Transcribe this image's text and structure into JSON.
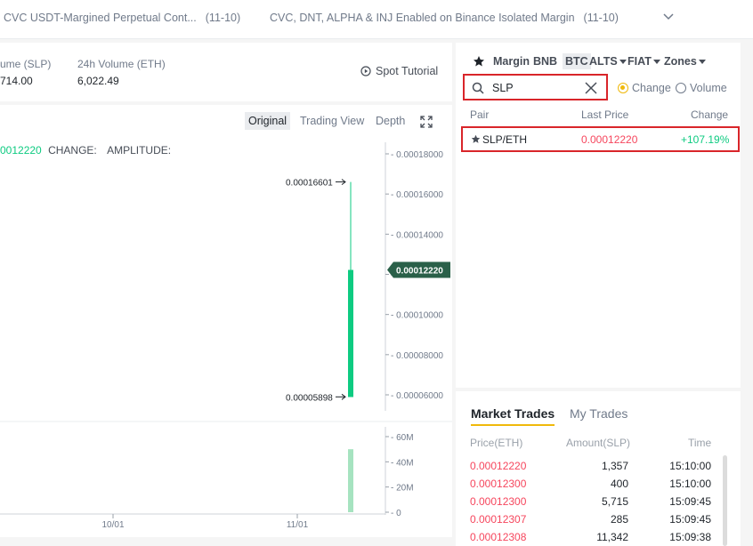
{
  "announcements": [
    {
      "text": "CVC USDT-Margined Perpetual Cont...",
      "date": "(11-10)"
    },
    {
      "text": "CVC, DNT, ALPHA & INJ Enabled on Binance Isolated Margin",
      "date": "(11-10)"
    }
  ],
  "stats": {
    "volume_slp_label": "ume (SLP)",
    "volume_slp_value": "714.00",
    "volume_eth_label": "24h Volume (ETH)",
    "volume_eth_value": "6,022.49",
    "tutorial_label": "Spot Tutorial"
  },
  "chart_view_tabs": [
    "Original",
    "Trading View",
    "Depth"
  ],
  "chart_info": {
    "price": "0012220",
    "change_label": "CHANGE:",
    "amplitude_label": "AMPLITUDE:"
  },
  "chart_data": {
    "type": "candlestick",
    "x_tick_labels": [
      "10/01",
      "11/01"
    ],
    "price_axis_ticks": [
      "0.00018000",
      "0.00016000",
      "0.00014000",
      "0.00012000",
      "0.00010000",
      "0.00008000",
      "0.00006000"
    ],
    "price_range": [
      5e-05,
      0.00018
    ],
    "candle": {
      "open": 5.89e-05,
      "close": 0.0001222,
      "high": 0.00016601,
      "low": 5.898e-05
    },
    "high_label": "0.00016601",
    "low_label": "0.00005898",
    "current_price_label": "0.00012220",
    "volume_axis_ticks": [
      "60M",
      "40M",
      "20M",
      "0"
    ],
    "volume_range": [
      0,
      60000000
    ],
    "volume": 50000000,
    "up_color": "#0ecb81",
    "current_tag_color": "#2a6049"
  },
  "market_tabs": [
    "Margin",
    "BNB",
    "BTC",
    "ALTS",
    "FIAT",
    "Zones"
  ],
  "market_tabs_with_caret": [
    "ALTS",
    "FIAT",
    "Zones"
  ],
  "selected_market_tab": "BTC",
  "search": {
    "value": "SLP"
  },
  "sort_options": [
    {
      "label": "Change",
      "selected": true
    },
    {
      "label": "Volume",
      "selected": false
    }
  ],
  "pairs_table": {
    "headers": [
      "Pair",
      "Last Price",
      "Change"
    ],
    "rows": [
      {
        "pair": "SLP/ETH",
        "last_price": "0.00012220",
        "change": "+107.19%"
      }
    ]
  },
  "trades": {
    "tabs": [
      "Market Trades",
      "My Trades"
    ],
    "headers": [
      "Price(ETH)",
      "Amount(SLP)",
      "Time"
    ],
    "rows": [
      {
        "price": "0.00012220",
        "amount": "1,357",
        "time": "15:10:00"
      },
      {
        "price": "0.00012300",
        "amount": "400",
        "time": "15:10:00"
      },
      {
        "price": "0.00012300",
        "amount": "5,715",
        "time": "15:09:45"
      },
      {
        "price": "0.00012307",
        "amount": "285",
        "time": "15:09:45"
      },
      {
        "price": "0.00012308",
        "amount": "11,342",
        "time": "15:09:38"
      }
    ]
  },
  "colors": {
    "up": "#0ecb81",
    "down": "#f6465d",
    "accent": "#f0b90b",
    "highlight": "#d9252a"
  }
}
